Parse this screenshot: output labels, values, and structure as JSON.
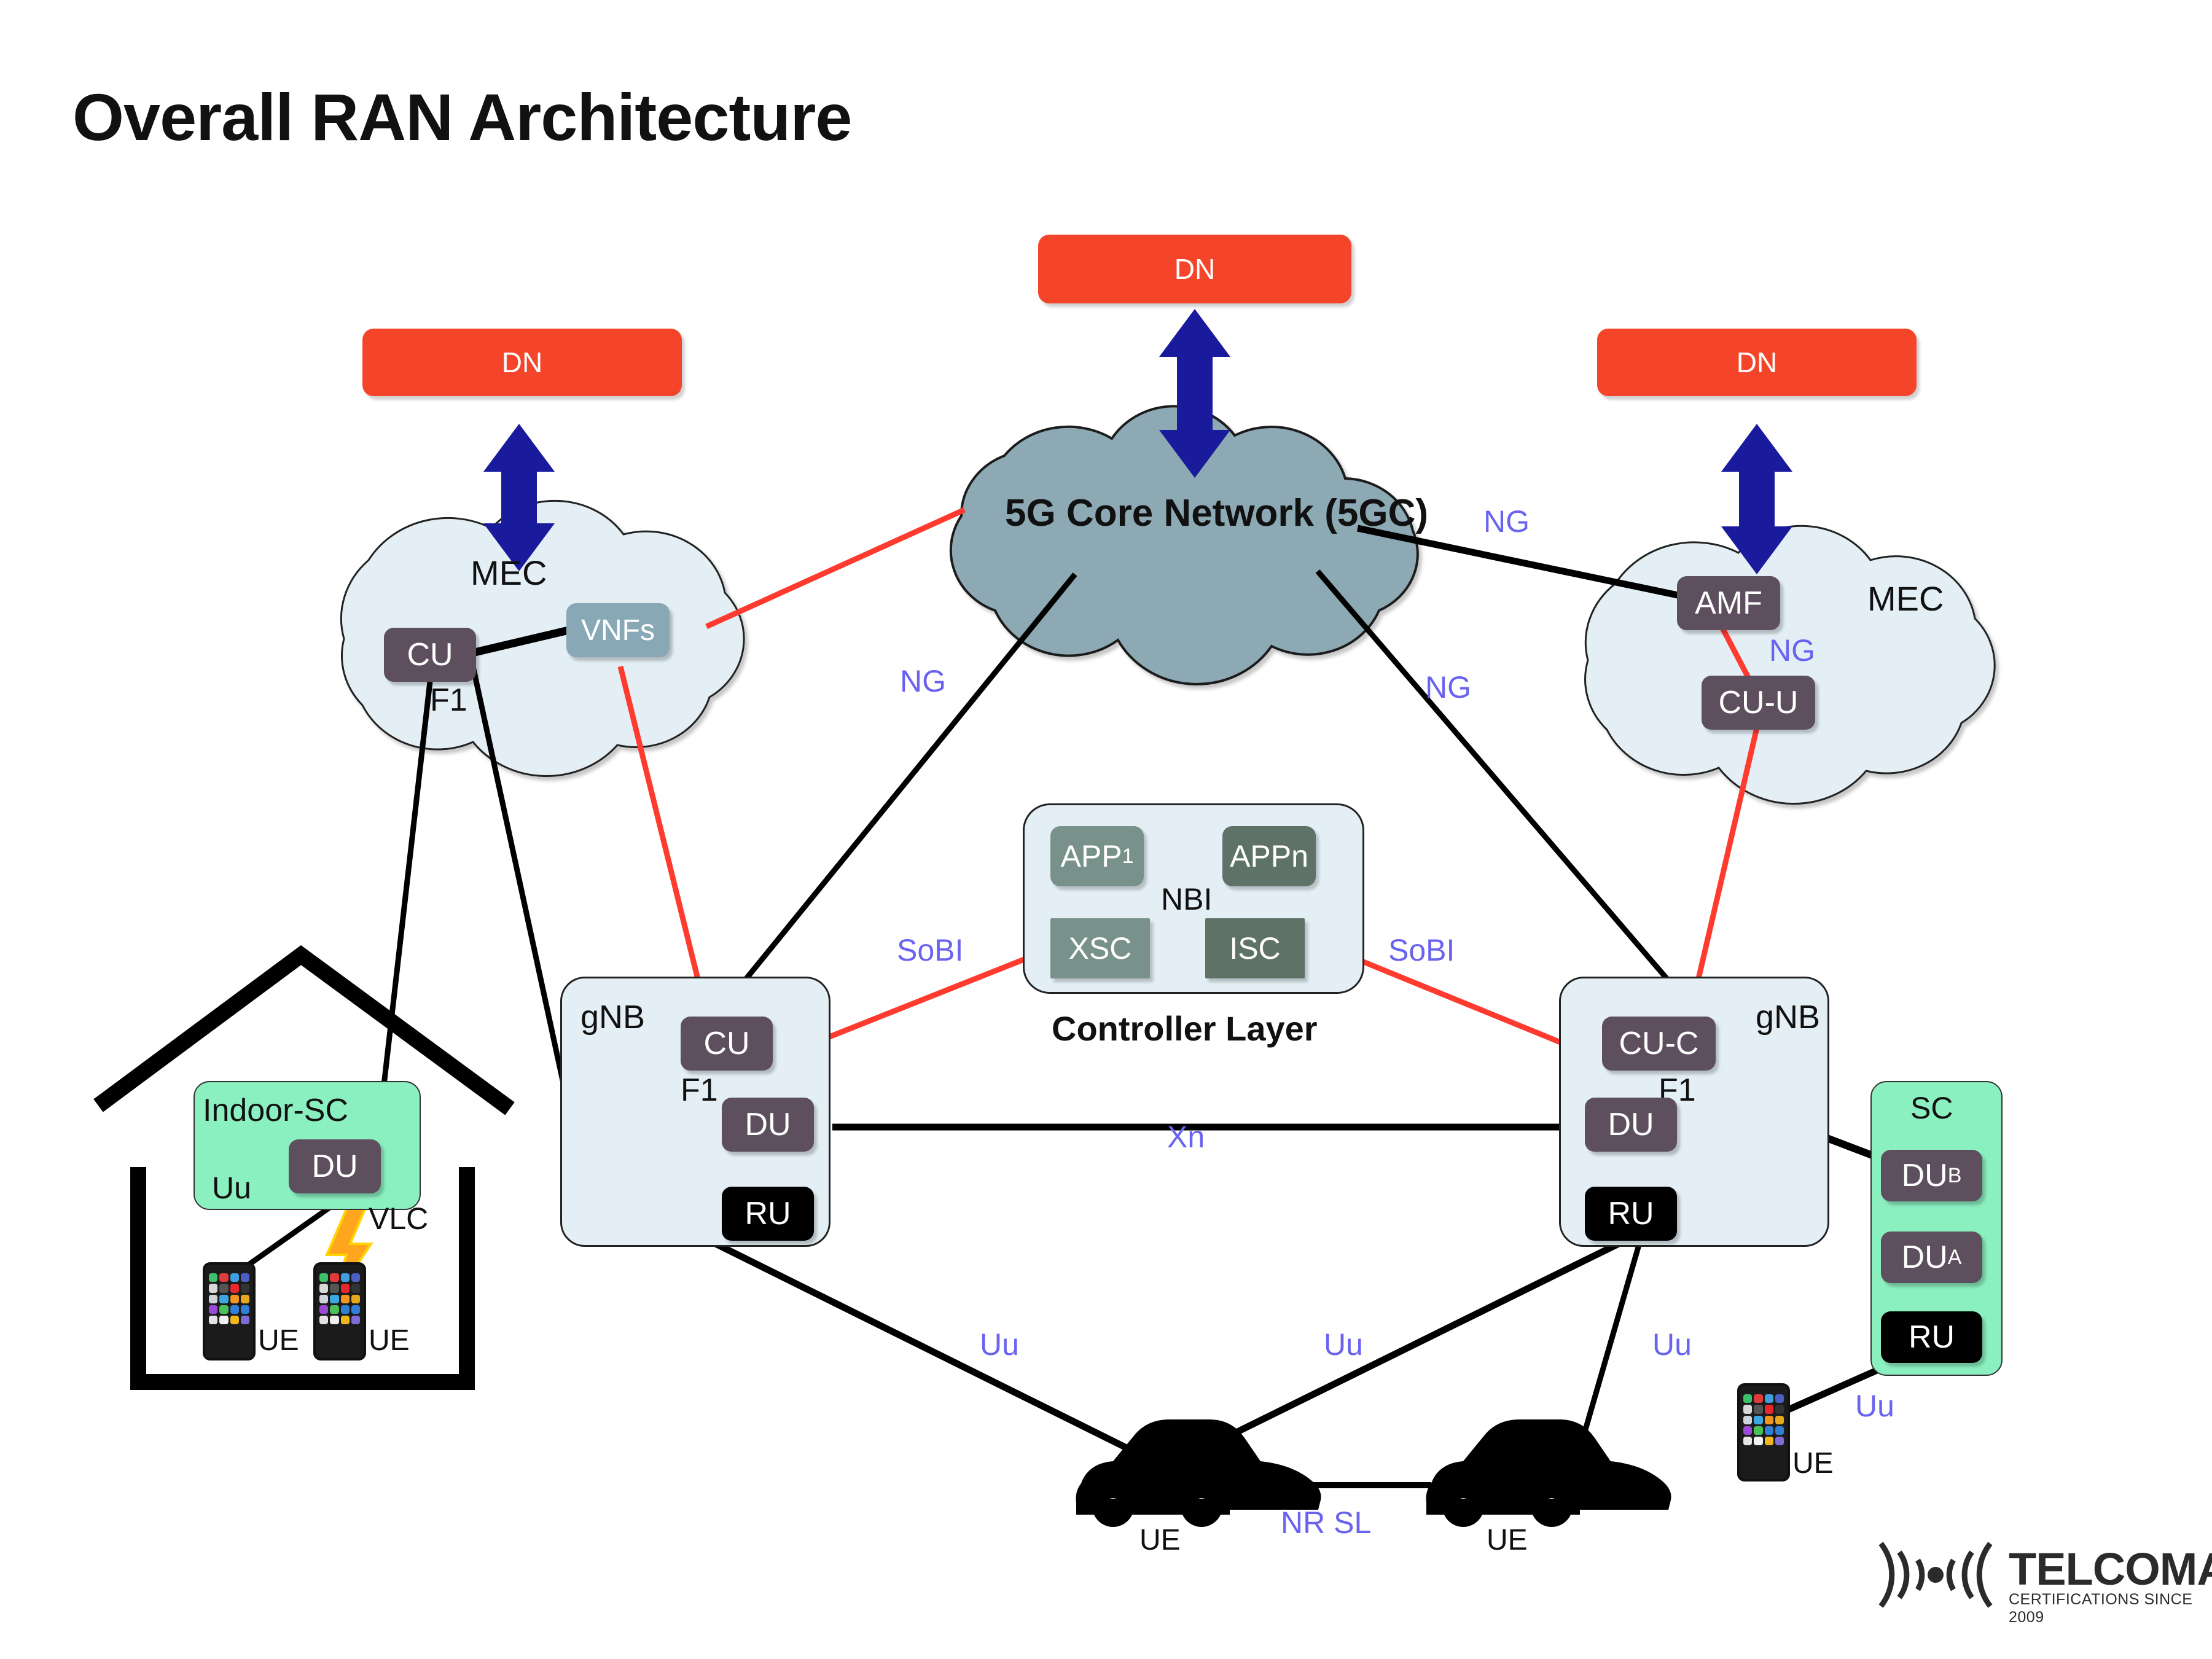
{
  "title": "Overall RAN Architecture",
  "colors": {
    "dn_box": "#F4452A",
    "node_chip": "#5D4F5E",
    "ru_chip": "#000000",
    "vnf_chip": "#89A8B6",
    "core_cloud": "#8CA9B4",
    "mec_cloud": "#E3EFF5",
    "gnb_panel": "#E3EFF5",
    "sc_panel": "#8BF0C0",
    "interface_label": "#6A63F0",
    "control_link": "#FF3B30",
    "data_link": "#000000",
    "dn_arrow": "#1A1A9C",
    "app_chip": "#78918A",
    "isc_chip": "#5E7268"
  },
  "data_networks": [
    {
      "label": "DN",
      "id": "dn-left"
    },
    {
      "label": "DN",
      "id": "dn-center"
    },
    {
      "label": "DN",
      "id": "dn-right"
    }
  ],
  "core": {
    "label": "5G Core Network (5GC)"
  },
  "mec_left": {
    "label": "MEC",
    "nodes": [
      {
        "label": "CU"
      },
      {
        "label": "VNFs"
      }
    ],
    "interface": "F1"
  },
  "mec_right": {
    "label": "MEC",
    "nodes": [
      {
        "label": "AMF"
      },
      {
        "label": "CU-U"
      }
    ],
    "interface": "NG"
  },
  "controller_layer": {
    "caption": "Controller Layer",
    "apps": [
      {
        "label": "APP",
        "sub": "1"
      },
      {
        "label": "APPn",
        "sub": ""
      }
    ],
    "divider_label": "NBI",
    "controllers": [
      {
        "label": "XSC"
      },
      {
        "label": "ISC"
      }
    ]
  },
  "gnb_left": {
    "label": "gNB",
    "nodes": [
      {
        "label": "CU"
      },
      {
        "label": "DU"
      },
      {
        "label": "RU"
      }
    ],
    "interface": "F1"
  },
  "gnb_right": {
    "label": "gNB",
    "nodes": [
      {
        "label": "CU-C"
      },
      {
        "label": "DU"
      },
      {
        "label": "RU"
      }
    ],
    "interface": "F1"
  },
  "small_cell_right": {
    "label": "SC",
    "nodes": [
      {
        "label": "DU",
        "sub": "B"
      },
      {
        "label": "DU",
        "sub": "A"
      },
      {
        "label": "RU",
        "sub": ""
      }
    ]
  },
  "indoor_small_cell": {
    "label": "Indoor-SC",
    "node": {
      "label": "DU"
    },
    "air_interface": "Uu",
    "optical_interface": "VLC",
    "ues": [
      {
        "label": "UE"
      },
      {
        "label": "UE"
      }
    ]
  },
  "vehicles": [
    {
      "label": "UE"
    },
    {
      "label": "UE"
    }
  ],
  "handset_ue": {
    "label": "UE"
  },
  "interface_labels": {
    "ng_core_left": "NG",
    "ng_core_right": "NG",
    "ng_mec_right_top": "NG",
    "ng_mec_right_inner": "NG",
    "sobi_left": "SoBI",
    "sobi_right": "SoBI",
    "xn": "Xn",
    "uu_car1": "Uu",
    "uu_car2": "Uu",
    "uu_car3": "Uu",
    "uu_handset": "Uu",
    "nr_sl": "NR  SL"
  },
  "brand": {
    "name": "TELCOMA",
    "tagline": "CERTIFICATIONS SINCE 2009"
  }
}
